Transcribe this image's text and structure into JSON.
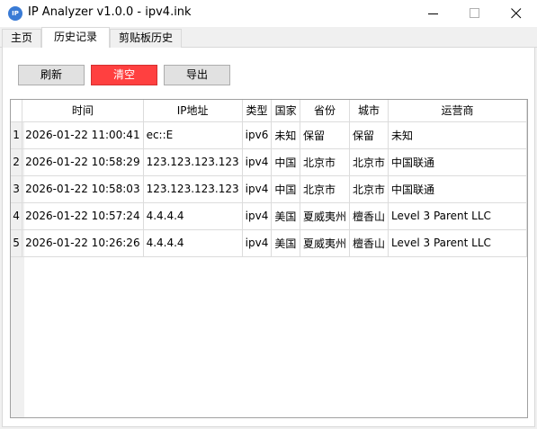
{
  "window": {
    "title": "IP Analyzer v1.0.0 - ipv4.ink",
    "icon_text": "IP",
    "accent": "#3a7bd5"
  },
  "tabs": [
    {
      "label": "主页",
      "active": false
    },
    {
      "label": "历史记录",
      "active": true
    },
    {
      "label": "剪贴板历史",
      "active": false
    }
  ],
  "toolbar": {
    "refresh_label": "刷新",
    "clear_label": "清空",
    "export_label": "导出",
    "clear_color": "#ff4040"
  },
  "table": {
    "columns": [
      "时间",
      "IP地址",
      "类型",
      "国家",
      "省份",
      "城市",
      "运营商"
    ],
    "rows": [
      {
        "n": "1",
        "cells": [
          "2026-01-22 11:00:41",
          "ec::E",
          "ipv6",
          "未知",
          "保留",
          "保留",
          "未知"
        ]
      },
      {
        "n": "2",
        "cells": [
          "2026-01-22 10:58:29",
          "123.123.123.123",
          "ipv4",
          "中国",
          "北京市",
          "北京市",
          "中国联通"
        ]
      },
      {
        "n": "3",
        "cells": [
          "2026-01-22 10:58:03",
          "123.123.123.123",
          "ipv4",
          "中国",
          "北京市",
          "北京市",
          "中国联通"
        ]
      },
      {
        "n": "4",
        "cells": [
          "2026-01-22 10:57:24",
          "4.4.4.4",
          "ipv4",
          "美国",
          "夏威夷州",
          "檀香山",
          "Level 3 Parent LLC"
        ]
      },
      {
        "n": "5",
        "cells": [
          "2026-01-22 10:26:26",
          "4.4.4.4",
          "ipv4",
          "美国",
          "夏威夷州",
          "檀香山",
          "Level 3 Parent LLC"
        ]
      }
    ]
  }
}
